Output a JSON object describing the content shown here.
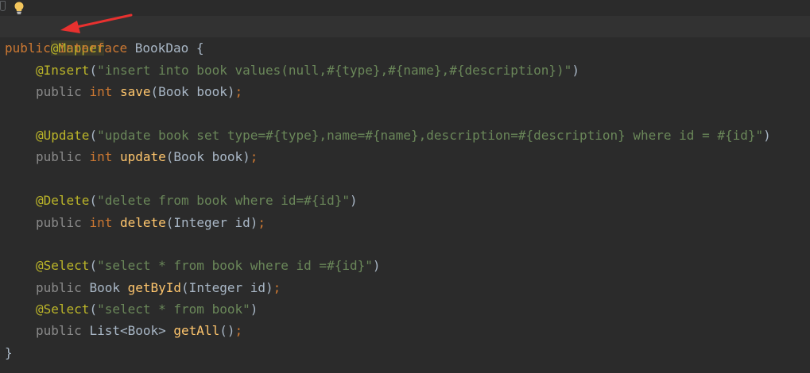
{
  "colors": {
    "background": "#2b2b2b",
    "current_line": "#323232",
    "keyword": "#cc7832",
    "annotation": "#bbb529",
    "string": "#6a8759",
    "method": "#ffc66d",
    "text": "#a9b7c6",
    "arrow": "#e8312f"
  },
  "gutter": {
    "bulb_icon": "lightbulb-icon",
    "fold_icon": "bookmark-icon"
  },
  "code": {
    "l1": {
      "ann": "@Mapper"
    },
    "l2": {
      "kw1": "public",
      "kw2": "interface",
      "name": "BookDao",
      "brace": " {"
    },
    "l3": {
      "ann": "@Insert",
      "open": "(",
      "str": "\"insert into book values(null,#{type},#{name},#{description})\"",
      "close": ")"
    },
    "l4": {
      "kw1": "public",
      "type": "int",
      "method": "save",
      "params": "(Book book)",
      "semi": ";"
    },
    "l6": {
      "ann": "@Update",
      "open": "(",
      "str": "\"update book set type=#{type},name=#{name},description=#{description} where id = #{id}\"",
      "close": ")"
    },
    "l7": {
      "kw1": "public",
      "type": "int",
      "method": "update",
      "params": "(Book book)",
      "semi": ";"
    },
    "l9": {
      "ann": "@Delete",
      "open": "(",
      "str": "\"delete from book where id=#{id}\"",
      "close": ")"
    },
    "l10": {
      "kw1": "public",
      "type": "int",
      "method": "delete",
      "params": "(Integer id)",
      "semi": ";"
    },
    "l12": {
      "ann": "@Select",
      "open": "(",
      "str": "\"select * from book where id =#{id}\"",
      "close": ")"
    },
    "l13": {
      "kw1": "public",
      "type": "Book",
      "method": "getById",
      "params": "(Integer id)",
      "semi": ";"
    },
    "l14": {
      "ann": "@Select",
      "open": "(",
      "str": "\"select * from book\"",
      "close": ")"
    },
    "l15": {
      "kw1": "public",
      "type": "List<Book>",
      "method": "getAll",
      "params": "()",
      "semi": ";"
    },
    "l16": {
      "brace": "}"
    }
  }
}
